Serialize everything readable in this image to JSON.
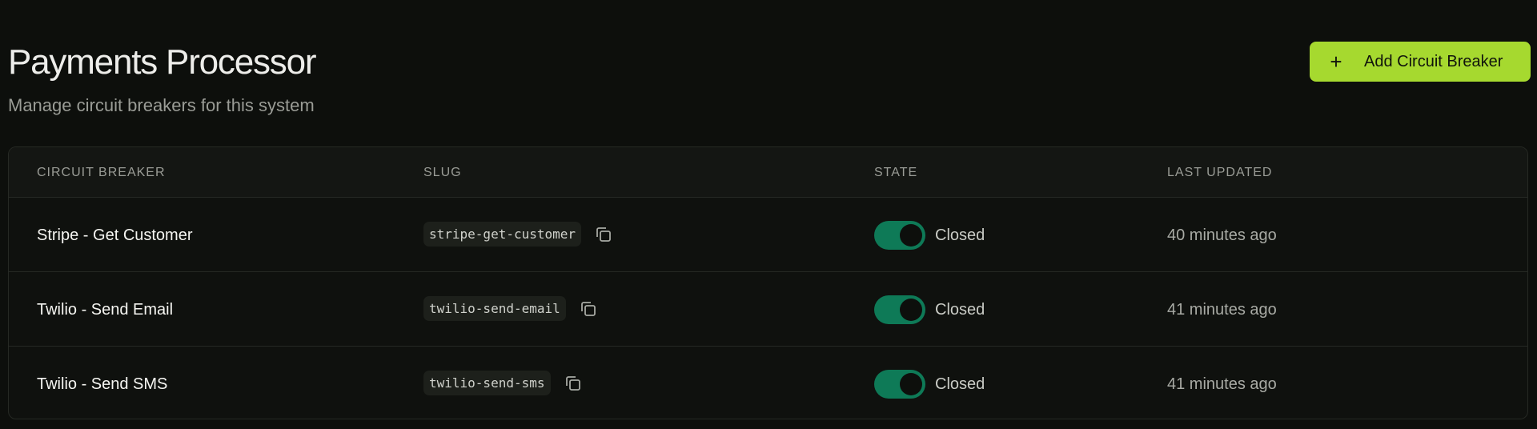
{
  "header": {
    "title": "Payments Processor",
    "subtitle": "Manage circuit breakers for this system",
    "add_button_label": "Add Circuit Breaker",
    "add_button_icon": "plus-icon"
  },
  "colors": {
    "accent": "#a6d92f",
    "toggle_on": "#0e7a57",
    "background": "#0d0f0c"
  },
  "table": {
    "columns": [
      "CIRCUIT BREAKER",
      "SLUG",
      "STATE",
      "LAST UPDATED"
    ],
    "rows": [
      {
        "name": "Stripe - Get Customer",
        "slug": "stripe-get-customer",
        "state": "Closed",
        "state_on": true,
        "last_updated": "40 minutes ago"
      },
      {
        "name": "Twilio - Send Email",
        "slug": "twilio-send-email",
        "state": "Closed",
        "state_on": true,
        "last_updated": "41 minutes ago"
      },
      {
        "name": "Twilio - Send SMS",
        "slug": "twilio-send-sms",
        "state": "Closed",
        "state_on": true,
        "last_updated": "41 minutes ago"
      }
    ]
  }
}
